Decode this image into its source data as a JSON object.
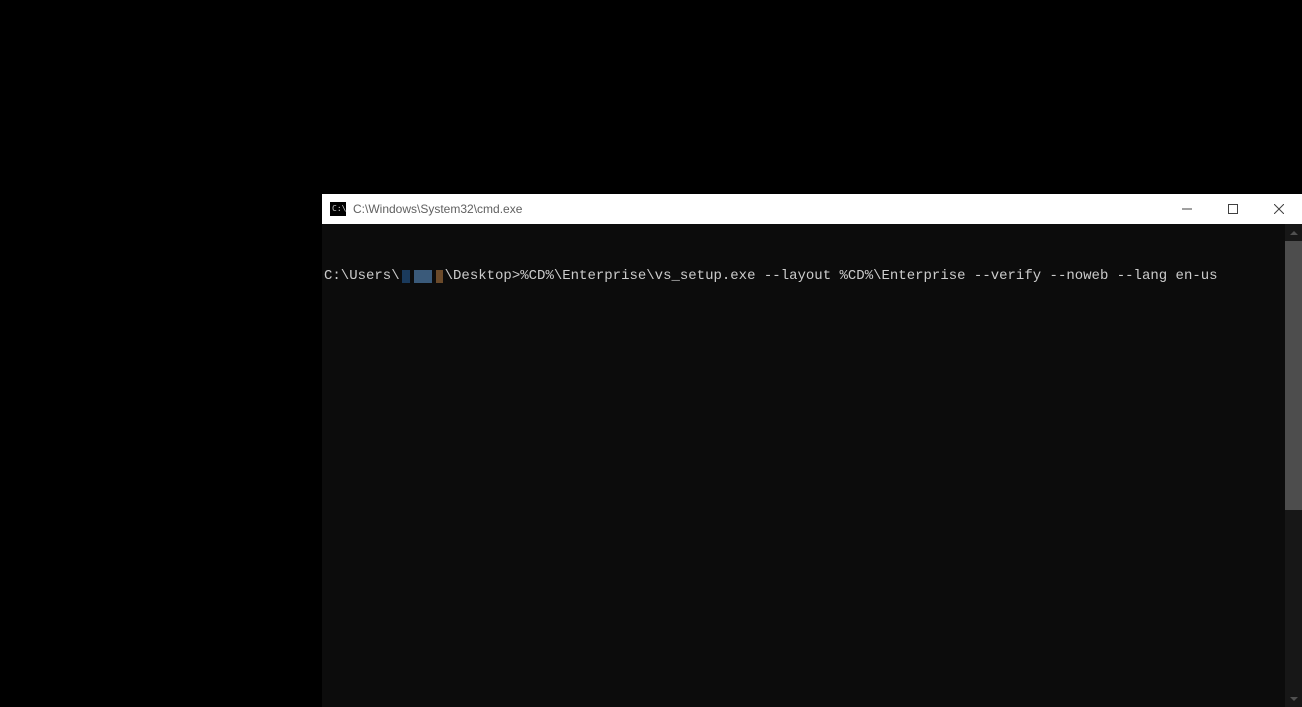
{
  "window": {
    "title": "C:\\Windows\\System32\\cmd.exe",
    "icon_label": "C:\\"
  },
  "console": {
    "prompt_prefix": "C:\\Users\\",
    "prompt_mid": "\\Desktop>",
    "command": "%CD%\\Enterprise\\vs_setup.exe --layout %CD%\\Enterprise --verify --noweb --lang en-us"
  },
  "scrollbar": {
    "thumb_top_pct": 0,
    "thumb_height_pct": 60
  }
}
